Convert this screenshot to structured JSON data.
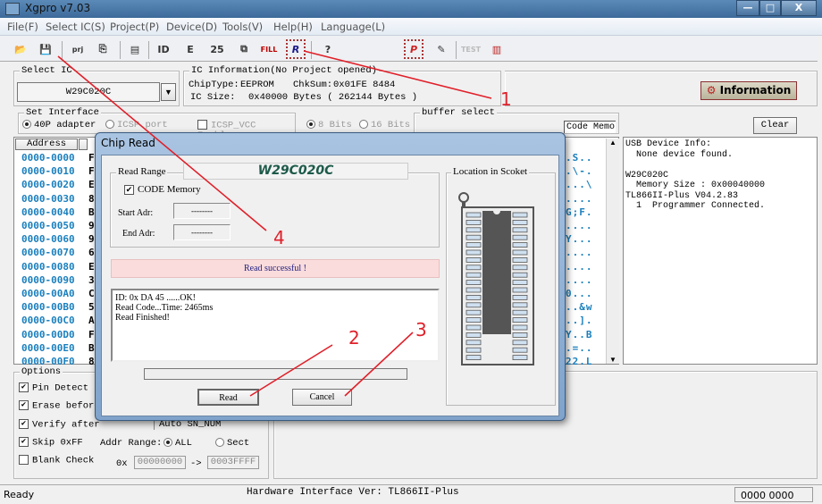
{
  "window": {
    "title": "Xgpro v7.03",
    "controls": [
      "—",
      "□",
      "X"
    ]
  },
  "menu": [
    "File(F)",
    "Select IC(S)",
    "Project(P)",
    "Device(D)",
    "Tools(V)",
    "Help(H)",
    "Language(L)"
  ],
  "toolbar": [
    {
      "name": "open-icon",
      "glyph": "📂"
    },
    {
      "name": "save-icon",
      "glyph": "💾"
    },
    {
      "name": "open-project-icon",
      "glyph": "prj"
    },
    {
      "name": "save-project-icon",
      "glyph": "⎘"
    },
    {
      "name": "buffer-icon",
      "glyph": "▤"
    },
    {
      "name": "read-id-icon",
      "glyph": "ID"
    },
    {
      "name": "erase-icon",
      "glyph": "E"
    },
    {
      "name": "blank-check-icon",
      "glyph": "25"
    },
    {
      "name": "verify-icon",
      "glyph": "⧉"
    },
    {
      "name": "fill-icon",
      "glyph": "FILL"
    },
    {
      "name": "read-icon",
      "glyph": "R"
    },
    {
      "name": "help-icon",
      "glyph": "?"
    },
    {
      "name": "program-icon",
      "glyph": "P"
    },
    {
      "name": "config-icon",
      "glyph": "✎"
    },
    {
      "name": "test-icon",
      "glyph": "TEST"
    },
    {
      "name": "chip-test-icon",
      "glyph": "▥"
    }
  ],
  "select_ic": {
    "label": "Select IC",
    "value": "W29C020C"
  },
  "ic_info": {
    "label": "IC Information(No Project opened)",
    "chiptype_label": "ChipType:",
    "chiptype": "EEPROM",
    "chksum_label": "ChkSum:",
    "chksum": "0x01FE 8484",
    "size_label": "IC Size:",
    "size": "0x40000 Bytes ( 262144 Bytes )"
  },
  "information_button": "Information",
  "interface": {
    "label": "Set Interface",
    "adapter": "40P adapter",
    "icsp": "ICSP port",
    "icsp_vcc": "ICSP_VCC Enable",
    "bits8": "8 Bits",
    "bits16": "16 Bits"
  },
  "buffer_select": {
    "label": "buffer select",
    "code_memo": "Code Memo"
  },
  "clear_button": "Clear",
  "hex": {
    "header": "Address",
    "rows": [
      {
        "addr": "0000-0000",
        "b": "F",
        "a": ".S.."
      },
      {
        "addr": "0000-0010",
        "b": "F",
        "a": ".\\-."
      },
      {
        "addr": "0000-0020",
        "b": "E",
        "a": "...\\"
      },
      {
        "addr": "0000-0030",
        "b": "8",
        "a": "...."
      },
      {
        "addr": "0000-0040",
        "b": "B",
        "a": "G;F."
      },
      {
        "addr": "0000-0050",
        "b": "9",
        "a": "...."
      },
      {
        "addr": "0000-0060",
        "b": "9",
        "a": "Y..."
      },
      {
        "addr": "0000-0070",
        "b": "6",
        "a": "...."
      },
      {
        "addr": "0000-0080",
        "b": "E",
        "a": "...."
      },
      {
        "addr": "0000-0090",
        "b": "3",
        "a": "...."
      },
      {
        "addr": "0000-00A0",
        "b": "C",
        "a": "0..."
      },
      {
        "addr": "0000-00B0",
        "b": "5",
        "a": "..&w"
      },
      {
        "addr": "0000-00C0",
        "b": "A",
        "a": "..]."
      },
      {
        "addr": "0000-00D0",
        "b": "F",
        "a": "Y..B"
      },
      {
        "addr": "0000-00E0",
        "b": "B",
        "a": ".=.."
      },
      {
        "addr": "0000-00F0",
        "b": "8",
        "a": "22.L"
      }
    ]
  },
  "log": "USB Device Info:\n  None device found.\n\nW29C020C\n  Memory Size : 0x00040000\nTL866II-Plus V04.2.83\n  1  Programmer Connected.",
  "options": {
    "label": "Options",
    "pin_detect": "Pin Detect",
    "erase_before": "Erase before",
    "verify_after": "Verify after",
    "skip_ff": "Skip 0xFF",
    "blank_check": "Blank Check",
    "auto_sn": "Auto SN_NUM",
    "addr_range": "Addr Range:",
    "all": "ALL",
    "sect": "Sect",
    "ox": "0x",
    "from": "00000000",
    "arrow": "->",
    "to": "0003FFFF"
  },
  "dialog": {
    "title": "Chip Read",
    "chip": "W29C020C",
    "read_range": "Read Range",
    "code_memory": "CODE Memory",
    "start_label": "Start Adr:",
    "start": "--------",
    "end_label": "End Adr:",
    "end": "--------",
    "location": "Location in Scoket",
    "message": "Read successful !",
    "log": [
      "ID: 0x DA 45 ......OK!",
      "Read Code...Time: 2465ms",
      "Read Finished!"
    ],
    "progress": 0,
    "read": "Read",
    "cancel": "Cancel"
  },
  "annotations": [
    "1",
    "2",
    "3",
    "4"
  ],
  "statusbar": {
    "left": "Ready",
    "center": "Hardware Interface Ver: TL866II-Plus",
    "right": "0000 0000"
  },
  "colors": {
    "annotation": "#e0202a",
    "address": "#1a7fbd",
    "title": "#3d6a9a",
    "message_bg": "#fbdcdc"
  }
}
